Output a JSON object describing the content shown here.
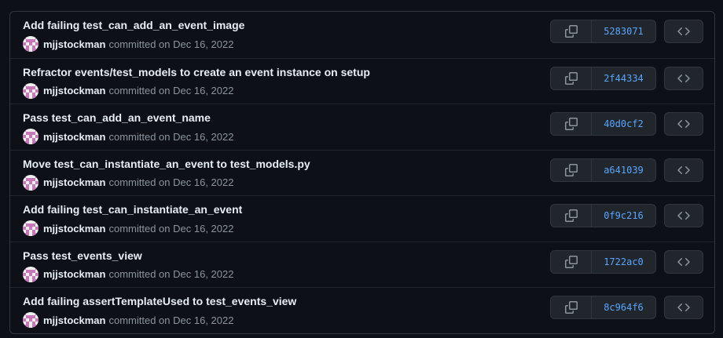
{
  "colors": {
    "background": "#0d1117",
    "border": "#30363d",
    "button_bg": "#21262d",
    "title_text": "#e6edf3",
    "muted_text": "#8b949e",
    "sha_link": "#58a6ff",
    "avatar_pink": "#c877b9"
  },
  "commits": [
    {
      "title": "Add failing test_can_add_an_event_image",
      "author": "mjjstockman",
      "committed": "committed on Dec 16, 2022",
      "sha": "5283071",
      "copy_icon": "copy-icon",
      "browse_icon": "code-icon"
    },
    {
      "title": "Refractor events/test_models to create an event instance on setup",
      "author": "mjjstockman",
      "committed": "committed on Dec 16, 2022",
      "sha": "2f44334",
      "copy_icon": "copy-icon",
      "browse_icon": "code-icon"
    },
    {
      "title": "Pass test_can_add_an_event_name",
      "author": "mjjstockman",
      "committed": "committed on Dec 16, 2022",
      "sha": "40d0cf2",
      "copy_icon": "copy-icon",
      "browse_icon": "code-icon"
    },
    {
      "title": "Move test_can_instantiate_an_event to test_models.py",
      "author": "mjjstockman",
      "committed": "committed on Dec 16, 2022",
      "sha": "a641039",
      "copy_icon": "copy-icon",
      "browse_icon": "code-icon"
    },
    {
      "title": "Add failing test_can_instantiate_an_event",
      "author": "mjjstockman",
      "committed": "committed on Dec 16, 2022",
      "sha": "0f9c216",
      "copy_icon": "copy-icon",
      "browse_icon": "code-icon"
    },
    {
      "title": "Pass test_events_view",
      "author": "mjjstockman",
      "committed": "committed on Dec 16, 2022",
      "sha": "1722ac0",
      "copy_icon": "copy-icon",
      "browse_icon": "code-icon"
    },
    {
      "title": "Add failing assertTemplateUsed to test_events_view",
      "author": "mjjstockman",
      "committed": "committed on Dec 16, 2022",
      "sha": "8c964f6",
      "copy_icon": "copy-icon",
      "browse_icon": "code-icon"
    }
  ]
}
